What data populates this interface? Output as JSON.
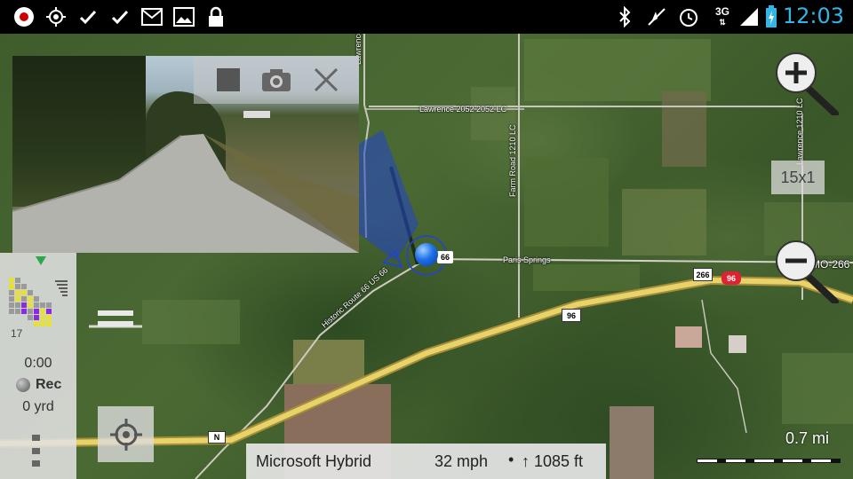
{
  "status_bar": {
    "left_icons": [
      "record-icon",
      "gps-target-icon",
      "check-icon",
      "check-icon",
      "gmail-icon",
      "gallery-icon",
      "lock-icon"
    ],
    "right_icons": [
      "bluetooth-icon",
      "mute-icon",
      "alarm-icon",
      "network-3g-icon",
      "signal-icon",
      "battery-charging-icon"
    ],
    "network_label": "3G",
    "time": "12:03",
    "accent": "#33b5e5"
  },
  "map": {
    "labels": {
      "lawrence_road": "Lawrence 2052  2052 LC",
      "farm_road": "Farm Road 1210 LC",
      "paris_springs": "Paris Springs",
      "route_66_shield": "66",
      "historic_route": "Historic Route 66 US 66",
      "mo_label": "MO-266",
      "shield_266": "266",
      "shield_96_red": "96",
      "shield_96_white": "96",
      "shield_n": "N",
      "lawrence_vertical": "Lawrence 1210 LC",
      "lawrence_left": "Lawrence"
    },
    "source": "Microsoft Hybrid",
    "speed": "32 mph",
    "separator": "•",
    "altitude": "↑ 1085 ft",
    "zoom_level": "15x1",
    "scale_label": "0.7 mi"
  },
  "recorder": {
    "point_count": "17",
    "time": "0:00",
    "rec_label": "Rec",
    "distance": "0 yrd"
  },
  "video_controls": {
    "icons": [
      "stop-icon",
      "camera-icon",
      "close-icon"
    ]
  },
  "colors": {
    "location_dot": "#1e6ee8",
    "view_cone": "#2244cc",
    "highway": "#e8d36a",
    "grid_yellow": "#e8e03a",
    "grid_purple": "#8a2be2"
  }
}
